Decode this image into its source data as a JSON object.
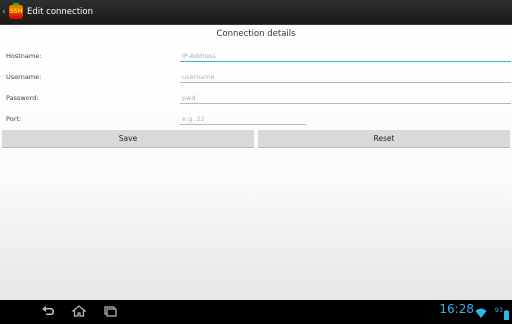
{
  "app": {
    "title": "Edit connection",
    "icon_text": "SSH",
    "icon_name": "ssh-app-icon"
  },
  "form": {
    "section_title": "Connection details",
    "fields": [
      {
        "label": "Hostname:",
        "placeholder": "IP-Address",
        "value": ""
      },
      {
        "label": "Username:",
        "placeholder": "username",
        "value": ""
      },
      {
        "label": "Password:",
        "placeholder": "pwd",
        "value": ""
      },
      {
        "label": "Port:",
        "placeholder": "e.g. 22",
        "value": ""
      }
    ],
    "save_label": "Save",
    "reset_label": "Reset"
  },
  "statusbar": {
    "time": "16:28",
    "battery_level": "93"
  },
  "colors": {
    "accent": "#33b5e5",
    "button_bg": "#d9d9d9"
  }
}
